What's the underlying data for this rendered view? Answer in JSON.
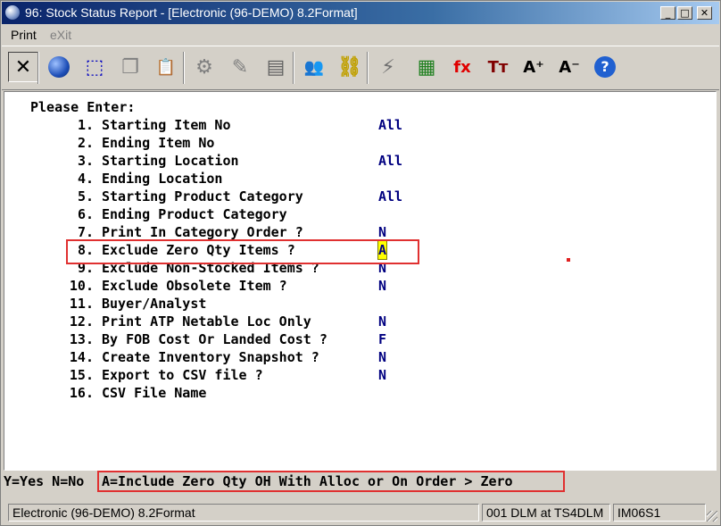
{
  "window": {
    "title": "96: Stock Status Report - [Electronic (96-DEMO) 8.2Format]",
    "controls": {
      "minimize": "_",
      "maximize": "□",
      "close": "✕"
    }
  },
  "menu": {
    "items": [
      {
        "label": "Print",
        "enabled": true
      },
      {
        "label": "eXit",
        "enabled": false
      }
    ]
  },
  "toolbar": {
    "buttons": [
      {
        "icon": "close-x-icon",
        "glyph": "✕",
        "color": "#000000"
      },
      {
        "icon": "globe-icon",
        "glyph": "●",
        "color": "#1e4fb8"
      },
      {
        "icon": "select-region-icon",
        "glyph": "⬚",
        "color": "#0000c0"
      },
      {
        "icon": "copy-icon",
        "glyph": "❐",
        "color": "#808080"
      },
      {
        "icon": "paste-icon",
        "glyph": "📋",
        "color": "#c09030"
      },
      {
        "icon": "settings-gear-icon",
        "glyph": "⚙",
        "color": "#808080"
      },
      {
        "icon": "edit-form-icon",
        "glyph": "✎",
        "color": "#808080"
      },
      {
        "icon": "list-view-icon",
        "glyph": "▤",
        "color": "#606060"
      },
      {
        "icon": "users-icon",
        "glyph": "👥",
        "color": "#808080"
      },
      {
        "icon": "link-chain-icon",
        "glyph": "⛓",
        "color": "#c0a000"
      },
      {
        "icon": "lightning-icon",
        "glyph": "⚡",
        "color": "#707070"
      },
      {
        "icon": "calendar-icon",
        "glyph": "▦",
        "color": "#208020"
      },
      {
        "icon": "function-fx-icon",
        "glyph": "fx",
        "color": "#e00000"
      },
      {
        "icon": "text-size-icon",
        "glyph": "Tт",
        "color": "#800000"
      },
      {
        "icon": "font-increase-icon",
        "glyph": "A⁺",
        "color": "#000000"
      },
      {
        "icon": "font-decrease-icon",
        "glyph": "A⁻",
        "color": "#000000"
      },
      {
        "icon": "help-icon",
        "glyph": "?",
        "color": "#2060d0"
      }
    ]
  },
  "screen": {
    "prompt": "Please Enter:",
    "fields": [
      {
        "num": "1.",
        "label": "Starting Item No",
        "value": "All"
      },
      {
        "num": "2.",
        "label": "Ending Item No",
        "value": ""
      },
      {
        "num": "3.",
        "label": "Starting Location",
        "value": "All"
      },
      {
        "num": "4.",
        "label": "Ending Location",
        "value": ""
      },
      {
        "num": "5.",
        "label": "Starting Product Category",
        "value": "All"
      },
      {
        "num": "6.",
        "label": "Ending Product Category",
        "value": ""
      },
      {
        "num": "7.",
        "label": "Print In Category Order ?",
        "value": "N"
      },
      {
        "num": "8.",
        "label": "Exclude Zero Qty Items ?",
        "value": "A",
        "active": true
      },
      {
        "num": "9.",
        "label": "Exclude Non-Stocked Items ?",
        "value": "N"
      },
      {
        "num": "10.",
        "label": "Exclude Obsolete Item ?",
        "value": "N"
      },
      {
        "num": "11.",
        "label": "Buyer/Analyst",
        "value": ""
      },
      {
        "num": "12.",
        "label": "Print ATP Netable Loc Only",
        "value": "N"
      },
      {
        "num": "13.",
        "label": "By FOB Cost Or Landed Cost ?",
        "value": "F"
      },
      {
        "num": "14.",
        "label": "Create Inventory Snapshot ?",
        "value": "N"
      },
      {
        "num": "15.",
        "label": "Export to CSV file ?",
        "value": "N"
      },
      {
        "num": "16.",
        "label": "CSV File Name",
        "value": ""
      }
    ]
  },
  "hint": {
    "options": "Y=Yes N=No",
    "highlighted": "A=Include Zero Qty OH With Alloc or On Order > Zero"
  },
  "status": {
    "company": "Electronic (96-DEMO) 8.2Format",
    "user": "001 DLM at TS4DLM",
    "program": "IM06S1"
  },
  "colors": {
    "value_text": "#000080",
    "highlight_box": "#e03030",
    "title_gradient_start": "#0a246a"
  }
}
